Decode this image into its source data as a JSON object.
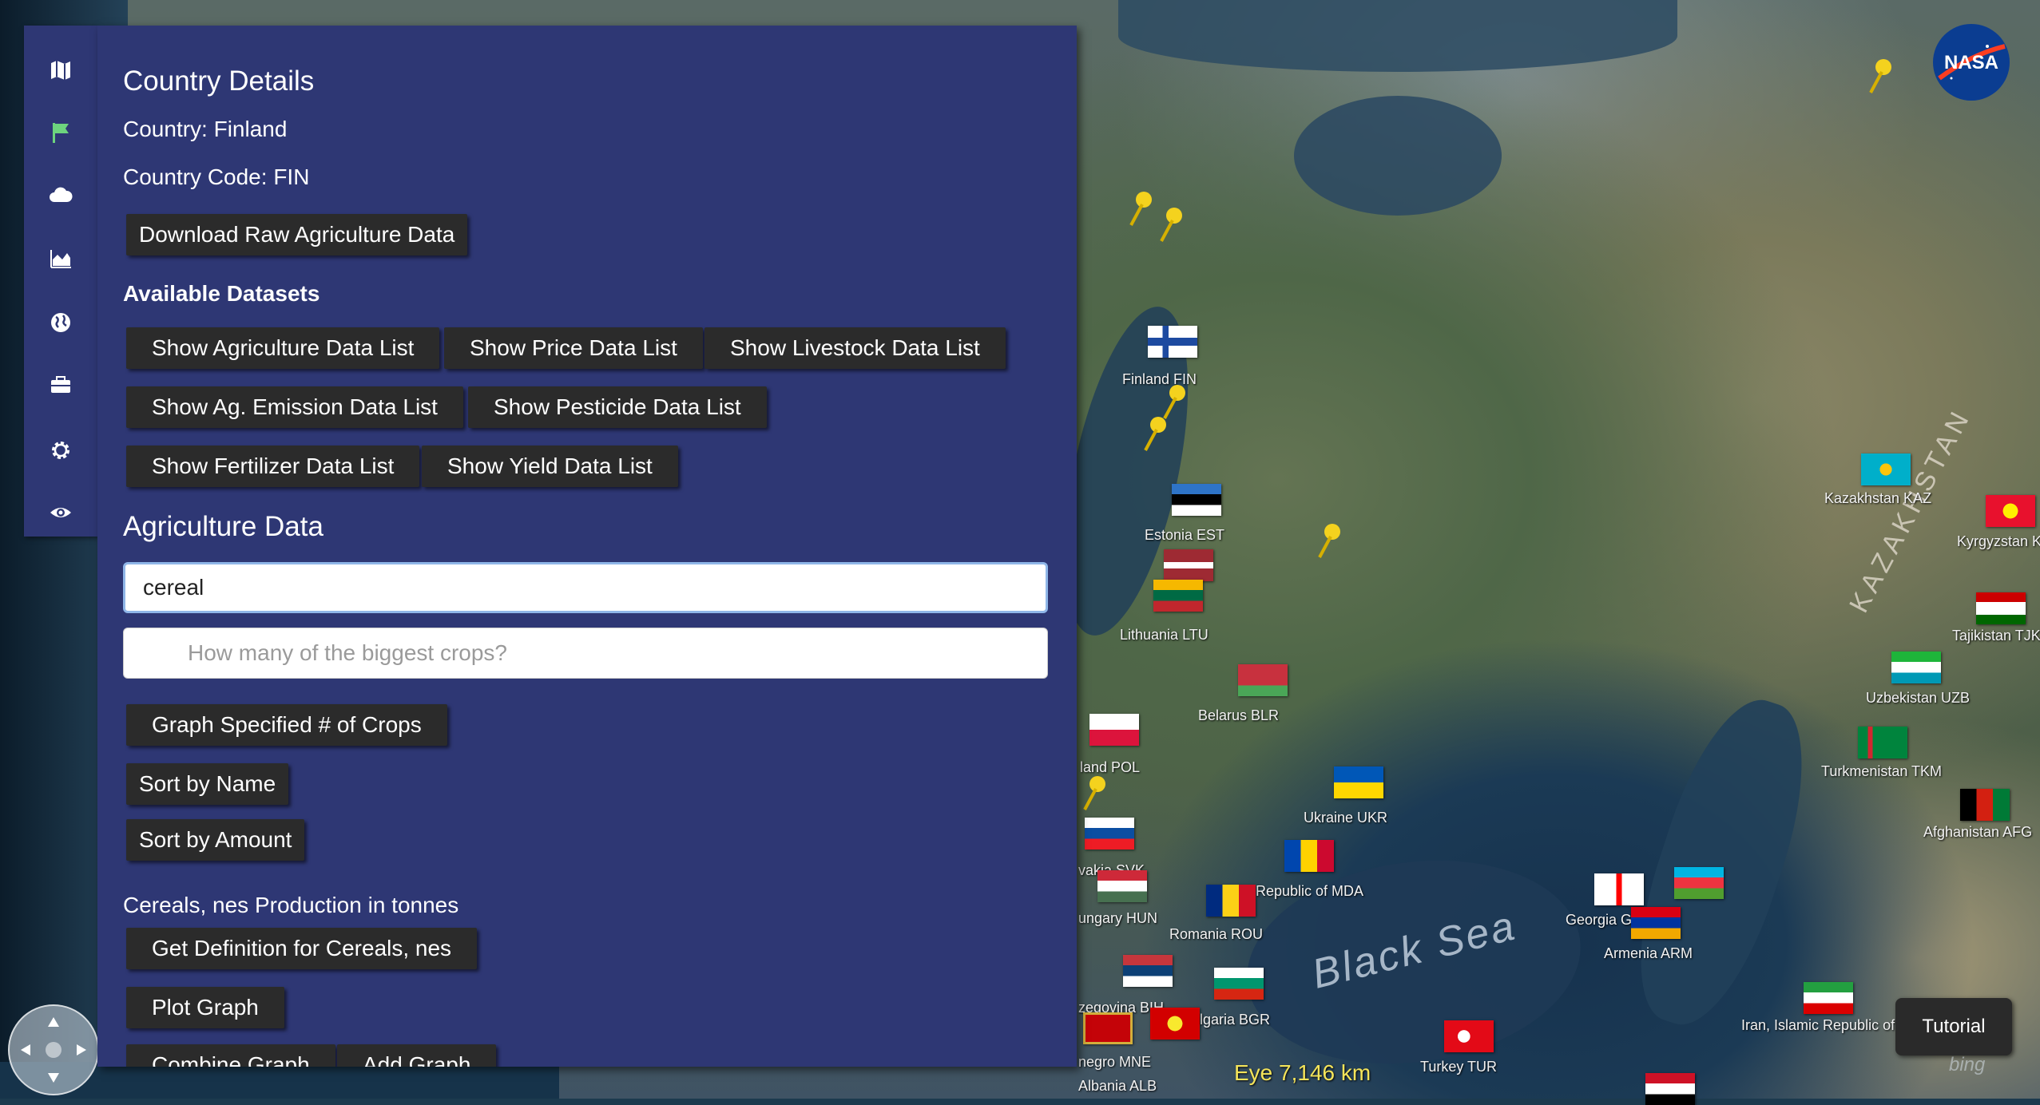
{
  "sidebar": {
    "icons": [
      "map-icon",
      "flag-icon",
      "cloud-icon",
      "area-chart-icon",
      "globe-icon",
      "briefcase-icon",
      "gear-icon",
      "eye-icon"
    ],
    "accent_color": "#6dd47e"
  },
  "panel": {
    "title": "Country Details",
    "country_line": "Country: Finland",
    "code_line": "Country Code: FIN",
    "download_button": "Download Raw Agriculture Data",
    "datasets_heading": "Available Datasets",
    "dataset_buttons": [
      "Show Agriculture Data List",
      "Show Price Data List",
      "Show Livestock Data List",
      "Show Ag. Emission Data List",
      "Show Pesticide Data List",
      "Show Fertilizer Data List",
      "Show Yield Data List"
    ],
    "ag_heading": "Agriculture Data",
    "search_value": "cereal",
    "crops_placeholder": "How many of the biggest crops?",
    "graph_button": "Graph Specified # of Crops",
    "sort_name_button": "Sort by Name",
    "sort_amount_button": "Sort by Amount",
    "result_title": "Cereals, nes Production in tonnes",
    "definition_button": "Get Definition for Cereals, nes",
    "plot_button": "Plot Graph",
    "combine_button": "Combine Graph",
    "add_graph_button": "Add Graph",
    "background_color": "#2e3774"
  },
  "map": {
    "labels": [
      "Finland FIN",
      "Estonia EST",
      "Lithuania LTU",
      "Belarus BLR",
      "Ukraine UKR",
      "Republic of MDA",
      "Romania ROU",
      "Bulgaria BGR",
      "Turkey TUR",
      "Georgia GEO",
      "Armenia ARM",
      "Kazakhstan KAZ",
      "Kyrgyzstan KGZ",
      "Tajikistan TJK",
      "Uzbekistan UZB",
      "Turkmenistan TKM",
      "Afghanistan AFG",
      "Iran, Islamic Republic of IRN",
      "land POL",
      "vakia SVK",
      "ungary HUN",
      "zegovina BIH",
      "negro MNE",
      "Albania ALB"
    ],
    "sea_label": "Black Sea",
    "region_label": "KAZAKHSTAN",
    "eye_altitude": "Eye  7,146 km",
    "tutorial_button": "Tutorial",
    "logo_text": "NASA",
    "attribution": "bing"
  }
}
